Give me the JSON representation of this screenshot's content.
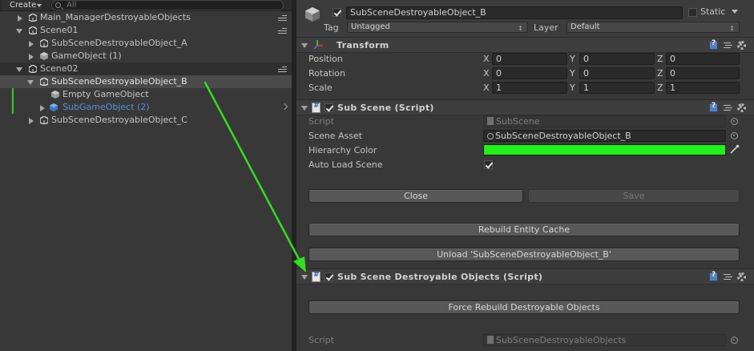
{
  "hierarchy": {
    "create_label": "Create",
    "search_placeholder": "All",
    "rows": [
      {
        "label": "Main_ManagerDestroyableObjects"
      },
      {
        "label": "Scene01"
      },
      {
        "label": "SubSceneDestroyableObject_A"
      },
      {
        "label": "GameObject (1)"
      },
      {
        "label": "Scene02"
      },
      {
        "label": "SubSceneDestroyableObject_B"
      },
      {
        "label": "Empty GameObject"
      },
      {
        "label": "SubGameObject (2)"
      },
      {
        "label": "SubSceneDestroyableObject_C"
      }
    ]
  },
  "inspector": {
    "object_name": "SubSceneDestroyableObject_B",
    "active": true,
    "static_label": "Static",
    "tag_label": "Tag",
    "tag_value": "Untagged",
    "layer_label": "Layer",
    "layer_value": "Default",
    "transform": {
      "title": "Transform",
      "position_label": "Position",
      "rotation_label": "Rotation",
      "scale_label": "Scale",
      "x_label": "X",
      "y_label": "Y",
      "z_label": "Z",
      "position": [
        "0",
        "0",
        "0"
      ],
      "rotation": [
        "0",
        "0",
        "0"
      ],
      "scale": [
        "1",
        "1",
        "1"
      ]
    },
    "subscene": {
      "title": "Sub Scene (Script)",
      "script_label": "Script",
      "script_value": "SubScene",
      "scene_asset_label": "Scene Asset",
      "scene_asset_value": "SubSceneDestroyableObject_B",
      "hierarchy_color_label": "Hierarchy Color",
      "hierarchy_color": "#22f01c",
      "auto_load_label": "Auto Load Scene",
      "auto_load": true,
      "close_label": "Close",
      "save_label": "Save",
      "rebuild_label": "Rebuild Entity Cache",
      "unload_label": "Unload 'SubSceneDestroyableObject_B'"
    },
    "destroyable": {
      "title": "Sub Scene Destroyable Objects (Script)",
      "force_rebuild_label": "Force Rebuild Destroyable Objects",
      "script_label": "Script",
      "script_value": "SubSceneDestroyableObjects"
    }
  },
  "colors": {
    "annotation_arrow": "#33dd22",
    "selection_text": "#5b8fd8"
  },
  "icons": [
    "unity-logo-icon",
    "gameobject-cube-icon",
    "transform-axes-icon",
    "script-icon",
    "help-book-icon",
    "preset-icon",
    "gear-icon",
    "eyedropper-icon",
    "object-picker-icon"
  ]
}
